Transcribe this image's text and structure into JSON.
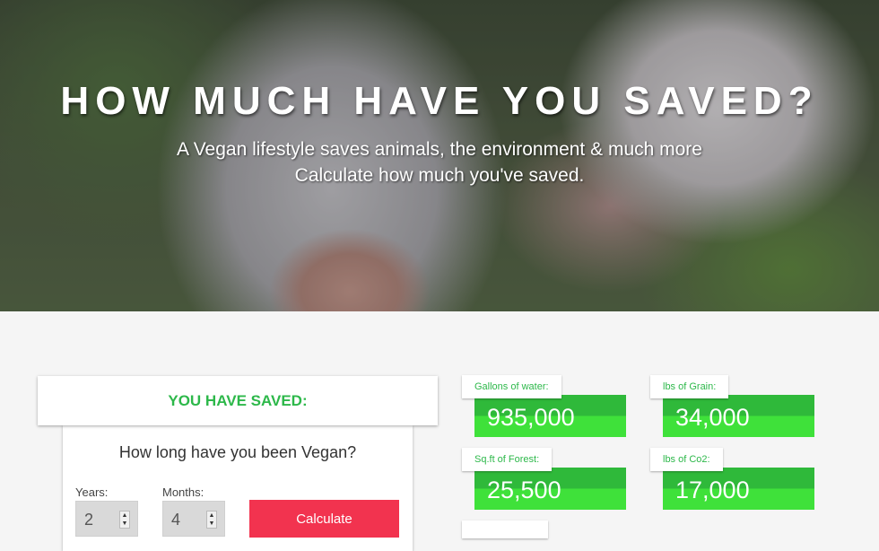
{
  "hero": {
    "title": "HOW MUCH HAVE YOU SAVED?",
    "subtitle_line1": "A Vegan lifestyle saves animals, the environment & much more",
    "subtitle_line2": "Calculate how much you've saved."
  },
  "calculator": {
    "saved_title": "YOU HAVE SAVED:",
    "question": "How long have you been Vegan?",
    "years_label": "Years:",
    "years_value": "2",
    "months_label": "Months:",
    "months_value": "4",
    "calculate_label": "Calculate"
  },
  "stats": [
    {
      "label": "Gallons of water:",
      "value": "935,000"
    },
    {
      "label": "lbs of Grain:",
      "value": "34,000"
    },
    {
      "label": "Sq.ft of Forest:",
      "value": "25,500"
    },
    {
      "label": "lbs of Co2:",
      "value": "17,000"
    }
  ],
  "colors": {
    "accent_green": "#2db84a",
    "stat_dark_green": "#2fb93a",
    "stat_light_green": "#3fe13a",
    "button_red": "#f2334f"
  }
}
